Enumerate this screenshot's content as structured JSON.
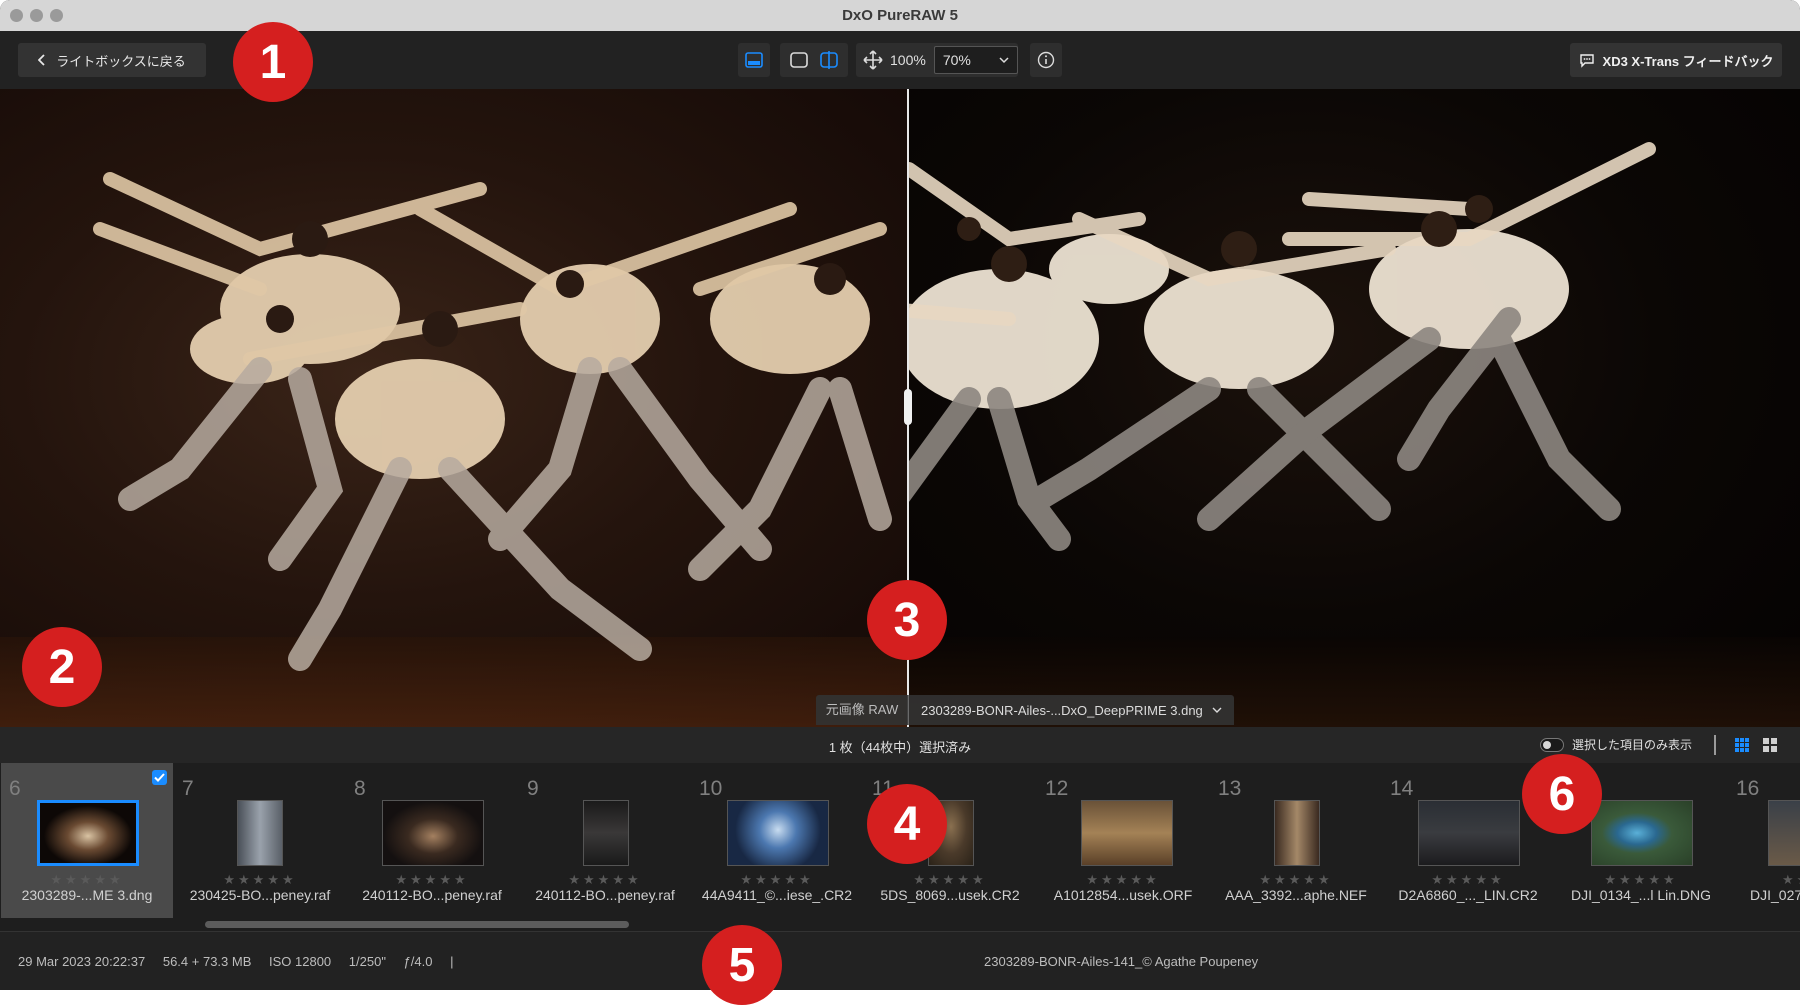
{
  "window": {
    "title": "DxO PureRAW 5"
  },
  "toolbar": {
    "back_label": "ライトボックスに戻る",
    "zoom_fit": "100%",
    "zoom_select": "70%",
    "feedback_label": "XD3 X-Trans フィードバック",
    "accent_color": "#1a8cff"
  },
  "viewer": {
    "source_label": "元画像 RAW",
    "output_file": "2303289-BONR-Ailes-...DxO_DeepPRIME 3.dng"
  },
  "selection": {
    "count_text": "1 枚（44枚中）選択済み",
    "toggle_label": "選択した項目のみ表示"
  },
  "filmstrip": {
    "items": [
      {
        "index": "6",
        "name": "2303289-...ME 3.dng",
        "stars": "★★★★★",
        "selected": true
      },
      {
        "index": "7",
        "name": "230425-BO...peney.raf",
        "stars": "★★★★★"
      },
      {
        "index": "8",
        "name": "240112-BO...peney.raf",
        "stars": "★★★★★"
      },
      {
        "index": "9",
        "name": "240112-BO...peney.raf",
        "stars": "★★★★★"
      },
      {
        "index": "10",
        "name": "44A9411_©...iese_.CR2",
        "stars": "★★★★★"
      },
      {
        "index": "11",
        "name": "5DS_8069...usek.CR2",
        "stars": "★★★★★"
      },
      {
        "index": "12",
        "name": "A1012854...usek.ORF",
        "stars": "★★★★★"
      },
      {
        "index": "13",
        "name": "AAA_3392...aphe.NEF",
        "stars": "★★★★★"
      },
      {
        "index": "14",
        "name": "D2A6860_..._LIN.CR2",
        "stars": "★★★★★"
      },
      {
        "index": "15",
        "name": "DJI_0134_...l Lin.DNG",
        "stars": "★★★★★"
      },
      {
        "index": "16",
        "name": "DJI_027",
        "stars": "★★★★★"
      }
    ]
  },
  "status": {
    "date": "29 Mar 2023 20:22:37",
    "size": "56.4 + 73.3 MB",
    "iso": "ISO 12800",
    "shutter": "1/250\"",
    "aperture": "ƒ/4.0",
    "divider": "|",
    "credit": "2303289-BONR-Ailes-141_© Agathe Poupeney"
  },
  "callouts": [
    "1",
    "2",
    "3",
    "4",
    "5",
    "6"
  ]
}
